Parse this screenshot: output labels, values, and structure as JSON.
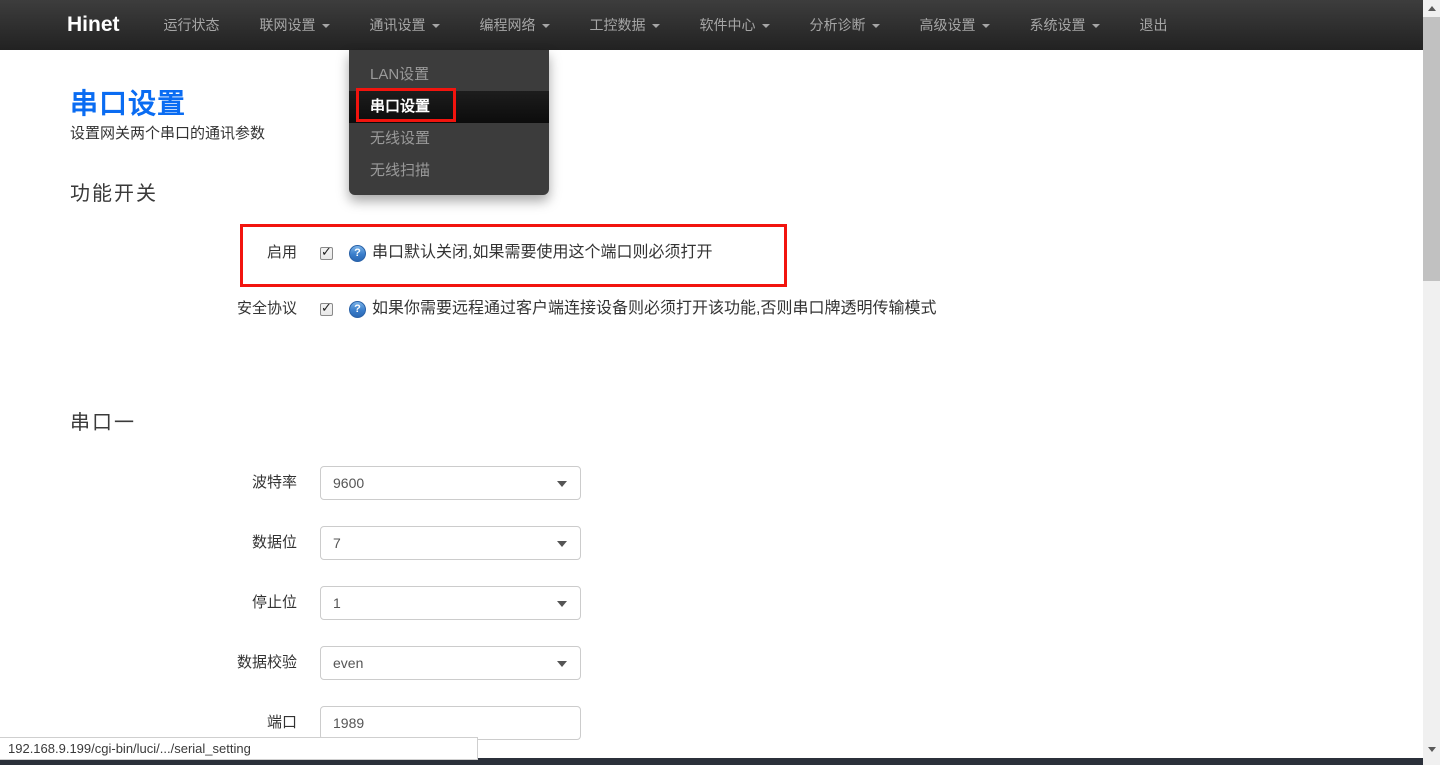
{
  "navbar": {
    "brand": "Hinet",
    "items": [
      {
        "label": "运行状态",
        "caret": false
      },
      {
        "label": "联网设置",
        "caret": true
      },
      {
        "label": "通讯设置",
        "caret": true,
        "open": true
      },
      {
        "label": "编程网络",
        "caret": true
      },
      {
        "label": "工控数据",
        "caret": true
      },
      {
        "label": "软件中心",
        "caret": true
      },
      {
        "label": "分析诊断",
        "caret": true
      },
      {
        "label": "高级设置",
        "caret": true
      },
      {
        "label": "系统设置",
        "caret": true
      },
      {
        "label": "退出",
        "caret": false
      }
    ]
  },
  "menu": {
    "items": [
      {
        "label": "LAN设置",
        "active": false
      },
      {
        "label": "串口设置",
        "active": true,
        "annotated": true
      },
      {
        "label": "无线设置",
        "active": false
      },
      {
        "label": "无线扫描",
        "active": false
      }
    ]
  },
  "content": {
    "title": "串口设置",
    "subtitle": "设置网关两个串口的通讯参数",
    "switches_heading": "功能开关",
    "serial_heading": "串口一"
  },
  "switches": {
    "rows": [
      {
        "label": "启用",
        "checked": true,
        "tip": "串口默认关闭,如果需要使用这个端口则必须打开",
        "annotated": true
      },
      {
        "label": "安全协议",
        "checked": true,
        "tip": "如果你需要远程通过客户端连接设备则必须打开该功能,否则串口牌透明传输模式"
      }
    ]
  },
  "serial": {
    "fields": [
      {
        "label": "波特率",
        "value": "9600",
        "type": "select"
      },
      {
        "label": "数据位",
        "value": "7",
        "type": "select"
      },
      {
        "label": "停止位",
        "value": "1",
        "type": "select"
      },
      {
        "label": "数据校验",
        "value": "even",
        "type": "select"
      },
      {
        "label": "端口",
        "value": "1989",
        "type": "text"
      }
    ]
  },
  "status_bar": {
    "url": "192.168.9.199/cgi-bin/luci/.../serial_setting"
  },
  "icons": {
    "checkmark": "✓",
    "help": "?"
  },
  "colors": {
    "accent_blue": "#0a6cf2",
    "annotation_red": "#f2140e",
    "navbar_top": "#3d3d3d",
    "navbar_bottom": "#222222"
  }
}
